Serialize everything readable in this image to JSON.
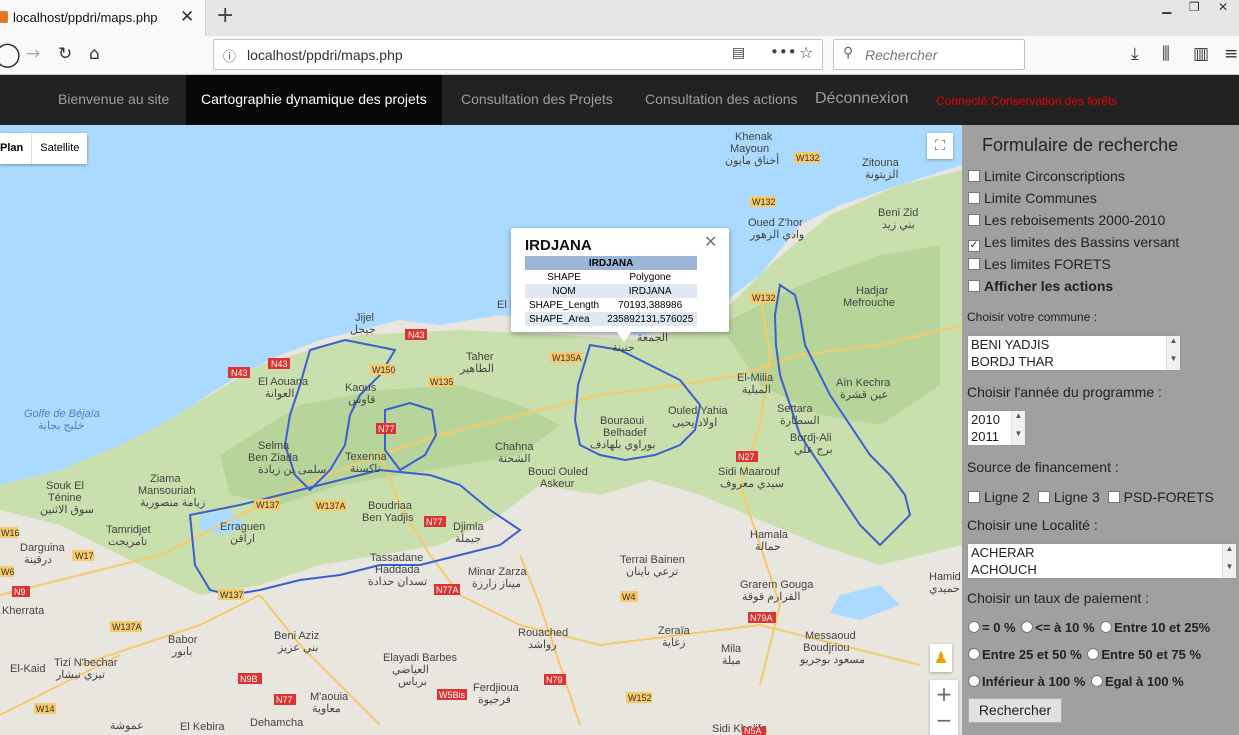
{
  "browser": {
    "tab_title": "localhost/ppdri/maps.php",
    "url": "localhost/ppdri/maps.php",
    "search_placeholder": "Rechercher"
  },
  "nav": {
    "items": [
      "Bienvenue au site",
      "Cartographie dynamique des projets",
      "Consultation des Projets",
      "Consultation des actions",
      "Déconnexion"
    ],
    "connected": "Connecté:Conservation des forêts"
  },
  "map": {
    "type_plan": "Plan",
    "type_satellite": "Satellite",
    "popup": {
      "title": "IRDJANA",
      "header": "IRDJANA",
      "rows": [
        {
          "k": "SHAPE",
          "v": "Polygone"
        },
        {
          "k": "NOM",
          "v": "IRDJANA"
        },
        {
          "k": "SHAPE_Length",
          "v": "70193,388986"
        },
        {
          "k": "SHAPE_Area",
          "v": "235892131,576025"
        }
      ]
    },
    "places": [
      "Jijel",
      "جيجل",
      "El Aouana",
      "العوانة",
      "Kaous",
      "قاوس",
      "Taher",
      "الطاهير",
      "Selma Ben Ziada",
      "سلمى بن زيادة",
      "Texenna",
      "تاكسنة",
      "Chahna",
      "الشحنة",
      "Bouraoui Belhadef",
      "بوراوي بلهادف",
      "Ouled Yahia",
      "اولاد يحيى",
      "El-Milia",
      "الميلية",
      "Settara",
      "السطارة",
      "Bordj-Ali",
      "برج علي",
      "Ziama Mansouriah",
      "زيامة منصورية",
      "Erraguen",
      "اراقن",
      "Boudriaa Ben Yadjis",
      "بودريعة بن ياجيس",
      "Djimla",
      "جيملة",
      "Tassadane Haddada",
      "تسدان حدادة",
      "Minar Zarza",
      "ميناز زارزة",
      "Terrai Bainen",
      "ترعي باينان",
      "Sidi Maarouf",
      "سيدي معروف",
      "Hamala",
      "حمالة",
      "Grarem Gouga",
      "القرارم قوقة",
      "Khenak Mayoun",
      "أخناق مايون",
      "Zitouna",
      "الزيتونة",
      "Oued Z'hor",
      "وادي الزهور",
      "Beni Zid",
      "بني زيد",
      "Hadjar Mefrouche",
      "Aïn Kechra",
      "عين قشرة",
      "Souk El Ténine",
      "سوق الاثنين",
      "Tamridjet",
      "تامريجت",
      "Darguina",
      "درقينة",
      "Kherrata",
      "Babor",
      "بابور",
      "Beni Aziz",
      "بني عزيز",
      "Tizi N'bechar",
      "تيزي نبشار",
      "El-Kaid",
      "Elayadi Barbes",
      "العياضي برباس",
      "M'aouia",
      "معاوية",
      "Ferdjioua",
      "فرجيوة",
      "Rouached",
      "رواشد",
      "Zeraïa",
      "زغاية",
      "Mila",
      "ميلة",
      "Messaoud Boudjriou",
      "مسعود بوجريو",
      "Dehamcha",
      "عموشة",
      "El Kebira",
      "Sidi Khelifa",
      "Golfe de Béjaïa",
      "خليج بجاية",
      "Hamid",
      "حميدي",
      "El H",
      "الجمعة",
      "جنينة"
    ],
    "roads": [
      "N43",
      "N43",
      "N43",
      "W150",
      "W135",
      "W135A",
      "N77",
      "W137",
      "W137A",
      "W137",
      "N77",
      "N77A",
      "W4",
      "N27",
      "W132",
      "W132",
      "W132",
      "W17",
      "W16",
      "N9",
      "W137A",
      "N9B",
      "N77",
      "W5Bis",
      "N79",
      "W152",
      "N79A",
      "W14",
      "N5A",
      "N6"
    ]
  },
  "form": {
    "title": "Formulaire de recherche",
    "layers": [
      {
        "label": "Limite Circonscriptions",
        "checked": false,
        "bold": false
      },
      {
        "label": "Limite Communes",
        "checked": false,
        "bold": false
      },
      {
        "label": "Les reboisements 2000-2010",
        "checked": false,
        "bold": false
      },
      {
        "label": "Les limites des Bassins versant",
        "checked": true,
        "bold": false
      },
      {
        "label": "Les limites FORETS",
        "checked": false,
        "bold": false
      },
      {
        "label": "Afficher les actions",
        "checked": false,
        "bold": true
      }
    ],
    "commune_label": "Choisir votre commune :",
    "communes": [
      "BENI YADJIS",
      "BORDJ THAR"
    ],
    "year_label": "Choisir l'année du programme :",
    "years": [
      "2010",
      "2011"
    ],
    "funding_label": "Source de financement :",
    "fundings": [
      "Ligne 2",
      "Ligne 3",
      "PSD-FORETS"
    ],
    "localite_label": "Choisir une Localité :",
    "localites": [
      "ACHERAR",
      "ACHOUCH"
    ],
    "taux_label": "Choisir un taux de paiement :",
    "taux_row1": [
      "= 0 %",
      "<= à 10 %",
      "Entre 10 et 25%"
    ],
    "taux_row2": [
      "Entre 25 et 50 %",
      "Entre 50 et 75 %"
    ],
    "taux_row3": [
      "Inférieur à 100 %",
      "Egal à 100 %"
    ],
    "search_button": "Rechercher"
  }
}
